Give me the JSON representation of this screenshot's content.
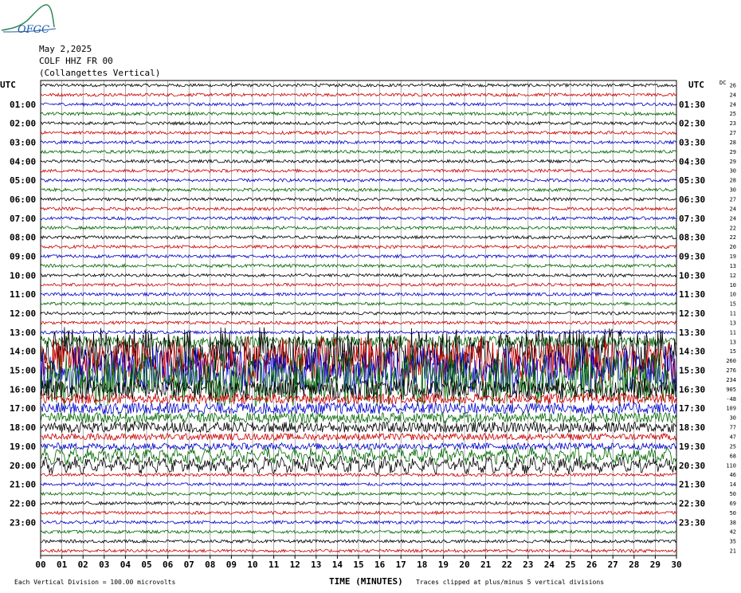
{
  "header": {
    "logo_text": "OFGC",
    "date": "May 2,2025",
    "station": "COLF HHZ FR 00",
    "location": "(Collangettes Vertical)"
  },
  "colors": {
    "trace_black": "#000000",
    "trace_red": "#cc0000",
    "trace_blue": "#0000cc",
    "trace_green": "#006600",
    "grid": "#000000",
    "logo_green": "#2e8b57",
    "logo_blue": "#1e5aa8"
  },
  "chart_data": {
    "type": "line",
    "title": "May 2,2025",
    "xlabel": "TIME (MINUTES)",
    "xlim": [
      0,
      30
    ],
    "x_ticks": [
      "00",
      "01",
      "02",
      "03",
      "04",
      "05",
      "06",
      "07",
      "08",
      "09",
      "10",
      "11",
      "12",
      "13",
      "14",
      "15",
      "16",
      "17",
      "18",
      "19",
      "20",
      "21",
      "22",
      "23",
      "24",
      "25",
      "26",
      "27",
      "28",
      "29",
      "30"
    ],
    "left_axis_title": "UTC",
    "right_axis_title": "UTC",
    "left_labels": [
      "01:00",
      "02:00",
      "03:00",
      "04:00",
      "05:00",
      "06:00",
      "07:00",
      "08:00",
      "09:00",
      "10:00",
      "11:00",
      "12:00",
      "13:00",
      "14:00",
      "15:00",
      "16:00",
      "17:00",
      "18:00",
      "19:00",
      "20:00",
      "21:00",
      "22:00",
      "23:00"
    ],
    "right_labels": [
      "01:30",
      "02:30",
      "03:30",
      "04:30",
      "05:30",
      "06:30",
      "07:30",
      "08:30",
      "09:30",
      "10:30",
      "11:30",
      "12:30",
      "13:30",
      "14:30",
      "15:30",
      "16:30",
      "17:30",
      "18:30",
      "19:30",
      "20:30",
      "21:30",
      "22:30",
      "23:30"
    ],
    "dc_label": "DC",
    "dc_offsets": [
      26,
      24,
      24,
      25,
      23,
      27,
      28,
      29,
      29,
      30,
      28,
      30,
      27,
      24,
      24,
      22,
      22,
      20,
      19,
      13,
      12,
      10,
      10,
      15,
      11,
      13,
      11,
      13,
      15,
      260,
      276,
      234,
      905,
      -48,
      109,
      30,
      77,
      47,
      25,
      68,
      110,
      46,
      14,
      50,
      69,
      50,
      38,
      42,
      35,
      21
    ],
    "trace_color_cycle": [
      "black",
      "red",
      "blue",
      "green"
    ],
    "footer_left": "Each Vertical Division = 100.00 microvolts",
    "footer_right": "Traces clipped at plus/minus 5 vertical divisions"
  }
}
